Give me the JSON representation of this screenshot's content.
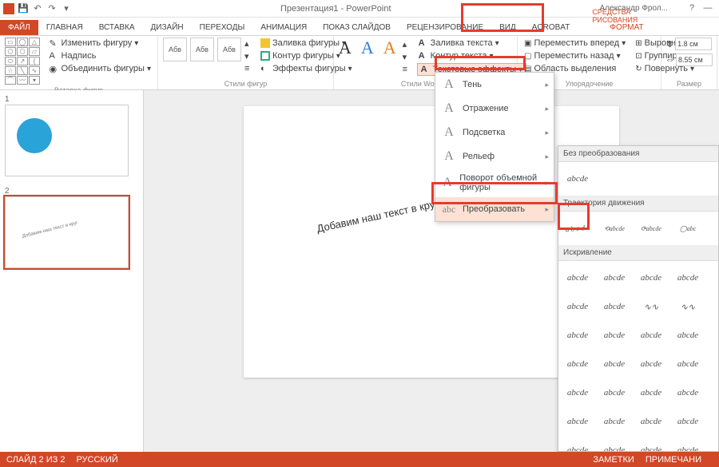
{
  "title": "Презентация1 - PowerPoint",
  "user": "Александр Фрол...",
  "tabs": {
    "file": "ФАЙЛ",
    "home": "ГЛАВНАЯ",
    "insert": "ВСТАВКА",
    "design": "ДИЗАЙН",
    "trans": "ПЕРЕХОДЫ",
    "anim": "АНИМАЦИЯ",
    "show": "ПОКАЗ СЛАЙДОВ",
    "review": "РЕЦЕНЗИРОВАНИЕ",
    "view": "ВИД",
    "acro": "ACROBAT",
    "ctxlabel": "СРЕДСТВА РИСОВАНИЯ",
    "format": "ФОРМАТ"
  },
  "ribbon": {
    "insertShapes": {
      "label": "Вставка фигур",
      "edit": "Изменить фигуру",
      "textbox": "Надпись",
      "merge": "Объединить фигуры"
    },
    "shapeStyles": {
      "label": "Стили фигур",
      "sample": "Абв",
      "fill": "Заливка фигуры",
      "outline": "Контур фигуры",
      "effects": "Эффекты фигуры"
    },
    "wordart": {
      "label": "Стили WordArt",
      "textfill": "Заливка текста",
      "textoutline": "Контур текста",
      "texteffects": "Текстовые эффекты"
    },
    "arrange": {
      "label": "Упорядочение",
      "fwd": "Переместить вперед",
      "back": "Переместить назад",
      "sel": "Область выделения",
      "align": "Выровнять",
      "group": "Группировать",
      "rotate": "Повернуть"
    },
    "size": {
      "label": "Размер",
      "h": "1.8 см",
      "w": "8.55 см"
    }
  },
  "dd": {
    "shadow": "Тень",
    "reflect": "Отражение",
    "glow": "Подсветка",
    "bevel": "Рельеф",
    "rot3d": "Поворот объемной фигуры",
    "transform": "Преобразовать"
  },
  "tp": {
    "none": "Без преобразования",
    "none_sample": "abcde",
    "path": "Траектория движения",
    "warp": "Искривление",
    "sample": "abcde"
  },
  "slide": {
    "text": "Добавим наш текст в круг"
  },
  "thumbs": {
    "n1": "1",
    "n2": "2"
  },
  "status": {
    "slide": "СЛАЙД 2 ИЗ 2",
    "lang": "РУССКИЙ",
    "notes": "ЗАМЕТКИ",
    "comments": "ПРИМЕЧАНИ"
  }
}
